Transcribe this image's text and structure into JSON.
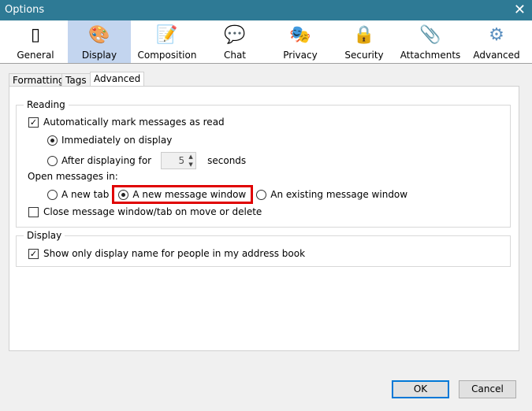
{
  "window": {
    "title": "Options",
    "close_glyph": "✕"
  },
  "toolbar": [
    {
      "label": "General",
      "icon": "general-switch-icon",
      "glyph": "▯"
    },
    {
      "label": "Display",
      "icon": "display-color-wheel-icon",
      "glyph": "🎨"
    },
    {
      "label": "Composition",
      "icon": "composition-pencil-icon",
      "glyph": "📝"
    },
    {
      "label": "Chat",
      "icon": "chat-bubble-icon",
      "glyph": "💬"
    },
    {
      "label": "Privacy",
      "icon": "privacy-mask-icon",
      "glyph": "🎭"
    },
    {
      "label": "Security",
      "icon": "security-padlock-icon",
      "glyph": "🔒"
    },
    {
      "label": "Attachments",
      "icon": "attachments-paperclip-icon",
      "glyph": "📎"
    },
    {
      "label": "Advanced",
      "icon": "advanced-gear-icon",
      "glyph": "⚙"
    }
  ],
  "selected_toolbar": "Display",
  "tabs": [
    "Formatting",
    "Tags",
    "Advanced"
  ],
  "selected_tab": "Advanced",
  "reading": {
    "legend": "Reading",
    "auto_mark": {
      "label": "Automatically mark messages as read",
      "checked": true
    },
    "immediately": {
      "label": "Immediately on display",
      "selected": true
    },
    "after": {
      "label": "After displaying for",
      "value": "5",
      "suffix": "seconds",
      "selected": false
    },
    "open_label": "Open messages in:",
    "open_options": [
      {
        "label": "A new tab",
        "selected": false
      },
      {
        "label": "A new message window",
        "selected": true
      },
      {
        "label": "An existing message window",
        "selected": false
      }
    ],
    "close_on_move": {
      "label": "Close message window/tab on move or delete",
      "checked": false
    }
  },
  "display": {
    "legend": "Display",
    "show_display_name": {
      "label": "Show only display name for people in my address book",
      "checked": true
    }
  },
  "buttons": {
    "ok": "OK",
    "cancel": "Cancel"
  },
  "colors": {
    "titlebar": "#2e7a95",
    "highlight": "#e00000",
    "selected_toolbar": "#c3d5ef"
  }
}
